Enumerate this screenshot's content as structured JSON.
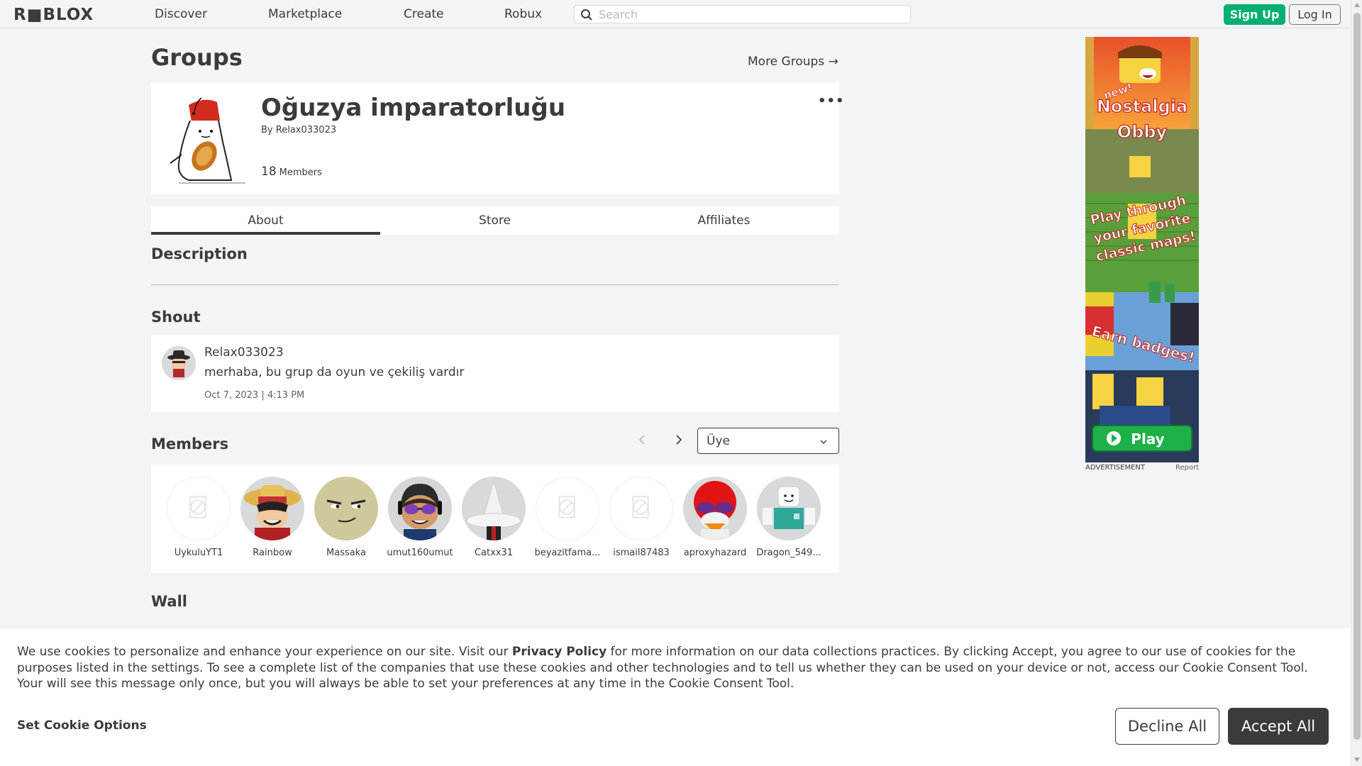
{
  "nav": {
    "logo": "R■BLOX",
    "links": [
      "Discover",
      "Marketplace",
      "Create",
      "Robux"
    ],
    "search_placeholder": "Search",
    "signup": "Sign Up",
    "login": "Log In"
  },
  "page": {
    "title": "Groups",
    "more_groups": "More Groups →"
  },
  "group": {
    "name": "Oğuzya imparatorluğu",
    "by_label": "By",
    "owner": "Relax033023",
    "member_count": "18",
    "members_label": "Members",
    "menu": "•••"
  },
  "tabs": [
    "About",
    "Store",
    "Affiliates"
  ],
  "sections": {
    "description": "Description",
    "shout": "Shout",
    "members": "Members",
    "wall": "Wall"
  },
  "shout": {
    "user": "Relax033023",
    "message": "merhaba, bu grup da oyun ve çekiliş vardır",
    "date": "Oct 7, 2023 | 4:13 PM"
  },
  "role_select": {
    "value": "Üye"
  },
  "members": [
    {
      "name": "UykuluYT1",
      "avatar": "blank"
    },
    {
      "name": "Rainbow",
      "avatar": "luffy"
    },
    {
      "name": "Massaka",
      "avatar": "face"
    },
    {
      "name": "umut160umut",
      "avatar": "glasses"
    },
    {
      "name": "Catxx31",
      "avatar": "hat"
    },
    {
      "name": "beyazitfama...",
      "avatar": "blank"
    },
    {
      "name": "ismail87483",
      "avatar": "blank"
    },
    {
      "name": "aproxyhazard",
      "avatar": "red"
    },
    {
      "name": "Dragon_549...",
      "avatar": "white"
    }
  ],
  "ad": {
    "badge": "new!",
    "title_1": "Nostalgia",
    "title_2": "Obby",
    "line_1": "Play through",
    "line_2": "your favorite",
    "line_3": "classic maps!",
    "earn": "Earn badges!",
    "play": "Play",
    "label": "ADVERTISEMENT",
    "report": "Report"
  },
  "cookie": {
    "text_1": "We use cookies to personalize and enhance your experience on our site. Visit our ",
    "privacy": "Privacy Policy",
    "text_2": " for more information on our data collections practices. By clicking Accept, you agree to our use of cookies for the purposes listed in the settings. To see a complete list of the companies that use these cookies and other technologies and to tell us whether they can be used on your device or not, access our Cookie Consent Tool. Your will see this message only once, but you will always be able to set your preferences at any time in the Cookie Consent Tool.",
    "set_options": "Set Cookie Options",
    "decline": "Decline All",
    "accept": "Accept All"
  }
}
